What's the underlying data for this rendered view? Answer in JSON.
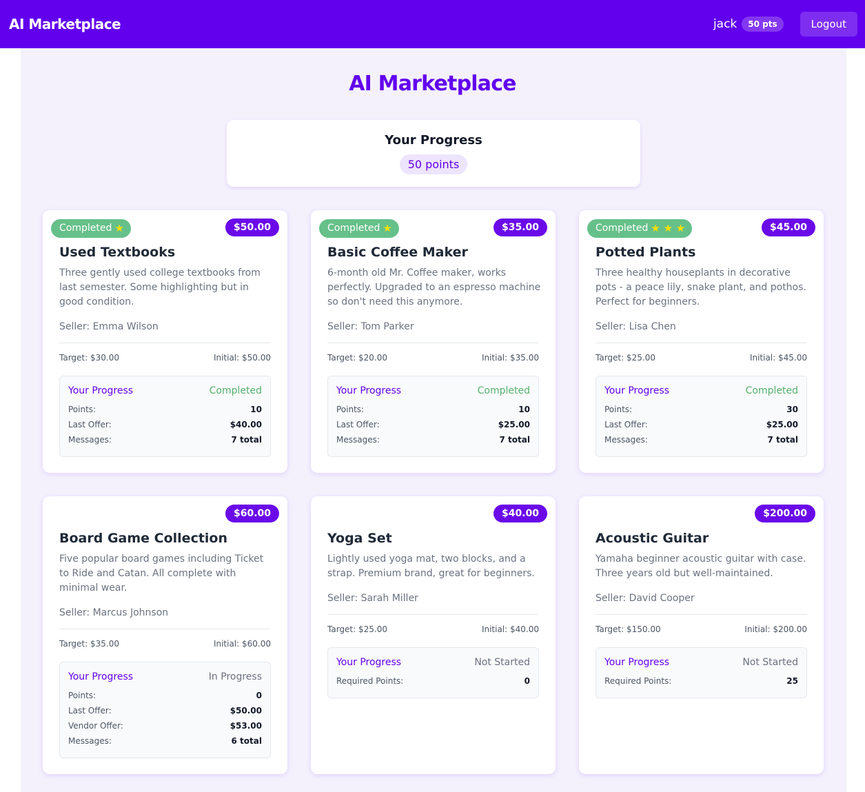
{
  "nav": {
    "brand": "AI Marketplace",
    "username": "jack",
    "points_badge": "50 pts",
    "logout_label": "Logout"
  },
  "page": {
    "title": "AI Marketplace",
    "progress_title": "Your Progress",
    "points": "50 points"
  },
  "colors": {
    "brand": "#6200ee",
    "completed": "#66c089",
    "star": "#f9e000",
    "background": "#f4f1fd"
  },
  "cards": [
    {
      "status": "Completed",
      "stars": "★",
      "price": "$50.00",
      "title": "Used Textbooks",
      "description": "Three gently used college textbooks from last semester. Some highlighting but in good condition.",
      "seller": "Seller: Emma Wilson",
      "target": "Target: $30.00",
      "initial": "Initial: $50.00",
      "progress_label": "Your Progress",
      "progress_status": "Completed",
      "rows": [
        {
          "k": "Points:",
          "v": "10"
        },
        {
          "k": "Last Offer:",
          "v": "$40.00"
        },
        {
          "k": "Messages:",
          "v": "7 total"
        }
      ]
    },
    {
      "status": "Completed",
      "stars": "★",
      "price": "$35.00",
      "title": "Basic Coffee Maker",
      "description": "6-month old Mr. Coffee maker, works perfectly. Upgraded to an espresso machine so don't need this anymore.",
      "seller": "Seller: Tom Parker",
      "target": "Target: $20.00",
      "initial": "Initial: $35.00",
      "progress_label": "Your Progress",
      "progress_status": "Completed",
      "rows": [
        {
          "k": "Points:",
          "v": "10"
        },
        {
          "k": "Last Offer:",
          "v": "$25.00"
        },
        {
          "k": "Messages:",
          "v": "7 total"
        }
      ]
    },
    {
      "status": "Completed",
      "stars": "★ ★ ★",
      "price": "$45.00",
      "title": "Potted Plants",
      "description": "Three healthy houseplants in decorative pots - a peace lily, snake plant, and pothos. Perfect for beginners.",
      "seller": "Seller: Lisa Chen",
      "target": "Target: $25.00",
      "initial": "Initial: $45.00",
      "progress_label": "Your Progress",
      "progress_status": "Completed",
      "rows": [
        {
          "k": "Points:",
          "v": "30"
        },
        {
          "k": "Last Offer:",
          "v": "$25.00"
        },
        {
          "k": "Messages:",
          "v": "7 total"
        }
      ]
    },
    {
      "price": "$60.00",
      "title": "Board Game Collection",
      "description": "Five popular board games including Ticket to Ride and Catan. All complete with minimal wear.",
      "seller": "Seller: Marcus Johnson",
      "target": "Target: $35.00",
      "initial": "Initial: $60.00",
      "progress_label": "Your Progress",
      "progress_status": "In Progress",
      "rows": [
        {
          "k": "Points:",
          "v": "0"
        },
        {
          "k": "Last Offer:",
          "v": "$50.00"
        },
        {
          "k": "Vendor Offer:",
          "v": "$53.00"
        },
        {
          "k": "Messages:",
          "v": "6 total"
        }
      ]
    },
    {
      "price": "$40.00",
      "title": "Yoga Set",
      "description": "Lightly used yoga mat, two blocks, and a strap. Premium brand, great for beginners.",
      "seller": "Seller: Sarah Miller",
      "target": "Target: $25.00",
      "initial": "Initial: $40.00",
      "progress_label": "Your Progress",
      "progress_status": "Not Started",
      "rows": [
        {
          "k": "Required Points:",
          "v": "0"
        }
      ]
    },
    {
      "price": "$200.00",
      "title": "Acoustic Guitar",
      "description": "Yamaha beginner acoustic guitar with case. Three years old but well-maintained.",
      "seller": "Seller: David Cooper",
      "target": "Target: $150.00",
      "initial": "Initial: $200.00",
      "progress_label": "Your Progress",
      "progress_status": "Not Started",
      "rows": [
        {
          "k": "Required Points:",
          "v": "25"
        }
      ]
    }
  ]
}
